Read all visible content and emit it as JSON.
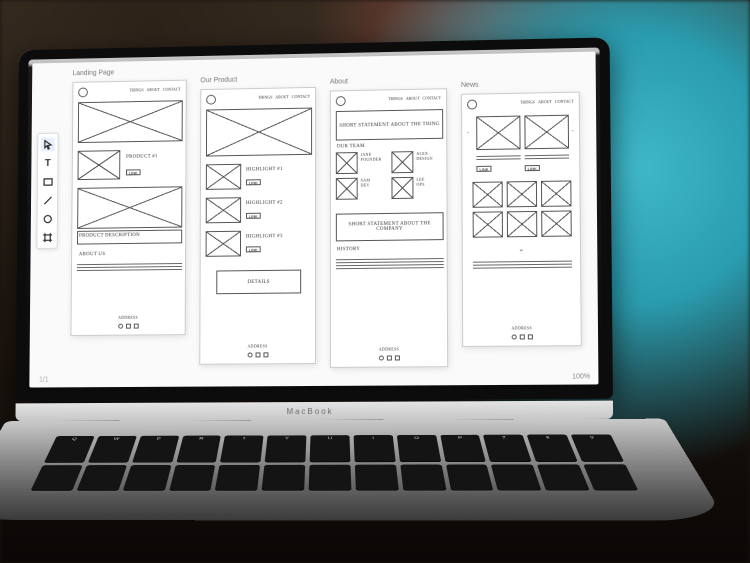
{
  "device_label": "MacBook",
  "zoom_label": "100%",
  "page_indicator": "1/1",
  "toolbar": {
    "tools": [
      {
        "name": "select-tool",
        "glyph": "arrow"
      },
      {
        "name": "text-tool",
        "glyph": "T"
      },
      {
        "name": "rect-tool",
        "glyph": "rect"
      },
      {
        "name": "line-tool",
        "glyph": "line"
      },
      {
        "name": "circle-tool",
        "glyph": "circ"
      },
      {
        "name": "artboard-tool",
        "glyph": "artb"
      }
    ]
  },
  "artboards": {
    "landing": {
      "title": "Landing Page",
      "nav": [
        "THINGS",
        "ABOUT",
        "CONTACT"
      ],
      "product_label": "PRODUCT #1",
      "cta": "LINK",
      "desc_label": "PRODUCT DESCRIPTION",
      "about_label": "ABOUT US",
      "footer_label": "ADDRESS"
    },
    "product": {
      "title": "Our Product",
      "nav": [
        "THINGS",
        "ABOUT",
        "CONTACT"
      ],
      "h1": "HIGHLIGHT #1",
      "h2": "HIGHLIGHT #2",
      "h3": "HIGHLIGHT #3",
      "cta": "LINK",
      "details": "DETAILS",
      "footer_label": "ADDRESS"
    },
    "about": {
      "title": "About",
      "nav": [
        "THINGS",
        "ABOUT",
        "CONTACT"
      ],
      "hero": "SHORT STATEMENT ABOUT THE THING",
      "team_label": "OUR TEAM",
      "members": [
        {
          "name": "JANE",
          "role": "FOUNDER"
        },
        {
          "name": "ALEX",
          "role": "DESIGN"
        },
        {
          "name": "SAM",
          "role": "DEV"
        },
        {
          "name": "LEE",
          "role": "OPS"
        }
      ],
      "statement2": "SHORT STATEMENT ABOUT THE COMPANY",
      "history_label": "HISTORY",
      "footer_label": "ADDRESS"
    },
    "news": {
      "title": "News",
      "nav": [
        "THINGS",
        "ABOUT",
        "CONTACT"
      ],
      "prev": "←",
      "next": "→",
      "cta": "LINK",
      "footer_label": "ADDRESS"
    }
  },
  "keyboard_row": [
    "Q",
    "W",
    "E",
    "R",
    "T",
    "Y",
    "U",
    "I",
    "O",
    "P",
    "7",
    "8",
    "9"
  ]
}
